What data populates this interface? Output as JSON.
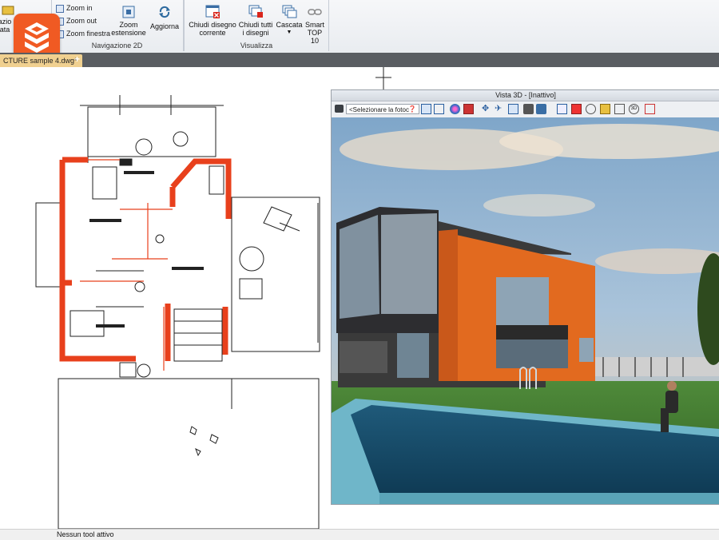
{
  "ribbon": {
    "partial_left_label_top": "azio",
    "partial_left_label_bottom": "ata",
    "zoom_in": "Zoom in",
    "zoom_out": "Zoom out",
    "zoom_window": "Zoom finestra",
    "zoom_extents_line1": "Zoom",
    "zoom_extents_line2": "estensione",
    "refresh": "Aggiorna",
    "close_drawing_line1": "Chiudi disegno",
    "close_drawing_line2": "corrente",
    "close_all_line1": "Chiudi tutti",
    "close_all_line2": "i disegni",
    "cascade": "Cascata",
    "smart_line1": "Smart",
    "smart_line2": "TOP 10",
    "group_nav": "Navigazione 2D",
    "group_view": "Visualizza"
  },
  "tabs": {
    "document_tab": "CTURE sample 4.dwg*",
    "add": "+"
  },
  "view3d": {
    "title": "Vista 3D - [Inattivo]",
    "camera_select": "<Selezionare la fotoc"
  },
  "status": {
    "text": "Nessun tool attivo"
  },
  "icons": [
    "app-logo-icon",
    "zoom-in-icon",
    "zoom-out-icon",
    "zoom-window-icon",
    "zoom-extents-icon",
    "refresh-icon",
    "close-drawing-icon",
    "close-all-icon",
    "cascade-icon",
    "smart-icon",
    "camera-icon",
    "help-icon"
  ],
  "colors": {
    "brand_orange": "#f05a23",
    "wall_red": "#e8401c",
    "tab_active": "#f0d090"
  }
}
